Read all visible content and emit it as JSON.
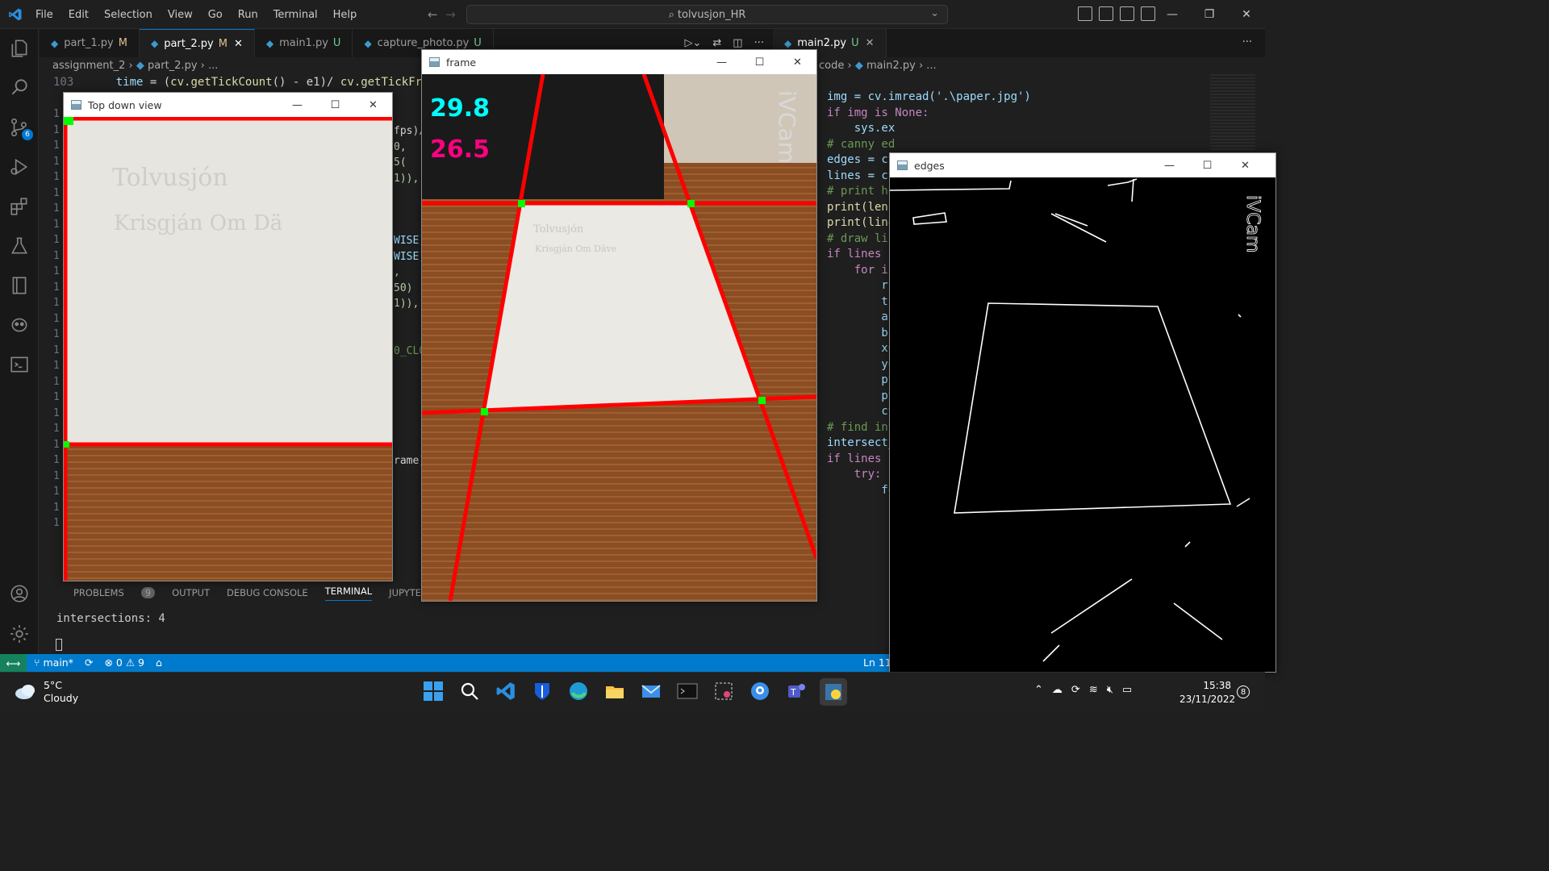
{
  "menu": [
    "File",
    "Edit",
    "Selection",
    "View",
    "Go",
    "Run",
    "Terminal",
    "Help"
  ],
  "search": {
    "text": "tolvusjon_HR"
  },
  "tabs": [
    {
      "label": "part_1.py",
      "status": "M"
    },
    {
      "label": "part_2.py",
      "status": "M",
      "close": "✕"
    },
    {
      "label": "main1.py",
      "status": "U"
    },
    {
      "label": "capture_photo.py",
      "status": "U"
    }
  ],
  "tabs_right": [
    {
      "label": "main2.py",
      "status": "U",
      "close": "✕"
    }
  ],
  "breadcrumb": {
    "folder": "assignment_2",
    "file": "part_2.py",
    "rest": "..."
  },
  "breadcrumb2": {
    "folder": "code",
    "file": "main2.py",
    "rest": "..."
  },
  "code_top": {
    "lineno": "103",
    "text_a": "time",
    "text_b": " = (",
    "fn1": "cv.getTickCount",
    "text_c": "() - e1)/ ",
    "fn2": "cv.getTickFrequ"
  },
  "left_fragments": [
    "fps)/",
    "0, 5(",
    "1)),",
    "WISE)",
    "WISE)",
    ", 50)",
    "1)),",
    "0_CLO",
    "rame)"
  ],
  "right_code": [
    {
      "t": "img = cv.imread('.\\paper.jpg')"
    },
    {
      "t": ""
    },
    {
      "t": ""
    },
    {
      "t": "if img is None:"
    },
    {
      "t": "    sys.ex"
    },
    {
      "t": ""
    },
    {
      "t": "# canny ed"
    },
    {
      "t": "edges = cv"
    },
    {
      "t": "lines = cv"
    },
    {
      "t": ""
    },
    {
      "t": "# print ho"
    },
    {
      "t": "print(len("
    },
    {
      "t": "print(line"
    },
    {
      "t": "# draw lin"
    },
    {
      "t": "if lines i"
    },
    {
      "t": "    for i"
    },
    {
      "t": "        rh"
    },
    {
      "t": "        th"
    },
    {
      "t": "        a"
    },
    {
      "t": "        b"
    },
    {
      "t": "        x0"
    },
    {
      "t": "        y0"
    },
    {
      "t": "        pt"
    },
    {
      "t": "        pt"
    },
    {
      "t": "        cv"
    },
    {
      "t": ""
    },
    {
      "t": "# find int"
    },
    {
      "t": "intersect_"
    },
    {
      "t": "if lines i"
    },
    {
      "t": "    try:"
    },
    {
      "t": "        fo"
    }
  ],
  "panel": {
    "tabs": [
      "PROBLEMS",
      "OUTPUT",
      "DEBUG CONSOLE",
      "TERMINAL",
      "JUPYTER"
    ],
    "problems_count": "9",
    "terminal_line": "intersections: 4"
  },
  "statusbar": {
    "branch": "main*",
    "errors": "0",
    "warnings": "9",
    "position": "Ln 11"
  },
  "windows": {
    "topdown": {
      "title": "Top down view",
      "handwriting_1": "Tolvusjón",
      "handwriting_2": "Krisgján  Om  Dä"
    },
    "frame": {
      "title": "frame",
      "fps_1": "29.8",
      "fps_2": "26.5",
      "watermark": "iVCam",
      "paper_1": "Tolvusjón",
      "paper_2": "Krisgján Om Däve"
    },
    "edges": {
      "title": "edges",
      "watermark": "iVCam"
    }
  },
  "taskbar": {
    "temp": "5°C",
    "condition": "Cloudy",
    "time": "15:38",
    "date": "23/11/2022",
    "notifications": "8"
  },
  "colors": {
    "accent": "#007acc",
    "remote": "#16825d",
    "overlay_line": "#ff0000",
    "overlay_point": "#00ff00",
    "fps_1": "#00ffff",
    "fps_2": "#ff0080"
  }
}
